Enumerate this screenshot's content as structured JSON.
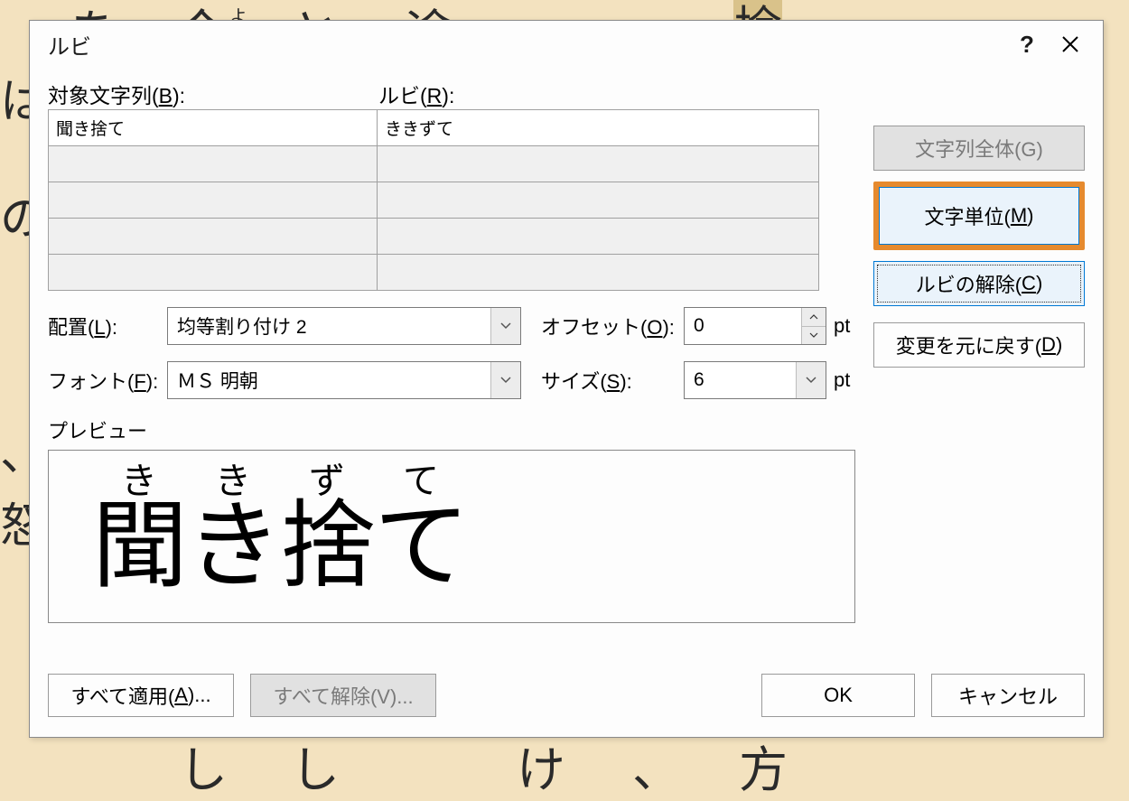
{
  "background_fragments": [
    "を",
    "今",
    "と",
    "途",
    "捨",
    "し",
    "け",
    "方"
  ],
  "dialog": {
    "title": "ルビ",
    "help": "?",
    "close": "✕",
    "labels": {
      "target_pre": "対象文字列(",
      "target_mn": "B",
      "target_post": "):",
      "ruby_pre": "ルビ(",
      "ruby_mn": "R",
      "ruby_post": "):"
    },
    "rows": [
      {
        "target": "聞き捨て",
        "ruby": "ききずて"
      },
      {
        "target": "",
        "ruby": ""
      },
      {
        "target": "",
        "ruby": ""
      },
      {
        "target": "",
        "ruby": ""
      },
      {
        "target": "",
        "ruby": ""
      }
    ],
    "side_buttons": {
      "whole": "文字列全体(G)",
      "per_char_pre": "文字単位(",
      "per_char_mn": "M",
      "per_char_post": ")",
      "clear_pre": "ルビの解除(",
      "clear_mn": "C",
      "clear_post": ")",
      "revert_pre": "変更を元に戻す(",
      "revert_mn": "D",
      "revert_post": ")"
    },
    "form": {
      "align_label_pre": "配置(",
      "align_mn": "L",
      "align_label_post": "):",
      "align_value": "均等割り付け 2",
      "offset_label_pre": "オフセット(",
      "offset_mn": "O",
      "offset_label_post": "):",
      "offset_value": "0",
      "offset_unit": "pt",
      "font_label_pre": "フォント(",
      "font_mn": "F",
      "font_label_post": "):",
      "font_value": "ＭＳ 明朝",
      "size_label_pre": "サイズ(",
      "size_mn": "S",
      "size_label_post": "):",
      "size_value": "6",
      "size_unit": "pt"
    },
    "preview": {
      "label": "プレビュー",
      "ruby_chars": [
        "き",
        "き",
        "ず",
        "て"
      ],
      "base": "聞き捨て"
    },
    "footer": {
      "apply_all_pre": "すべて適用(",
      "apply_all_mn": "A",
      "apply_all_post": ")...",
      "remove_all": "すべて解除(V)...",
      "ok": "OK",
      "cancel": "キャンセル"
    }
  }
}
